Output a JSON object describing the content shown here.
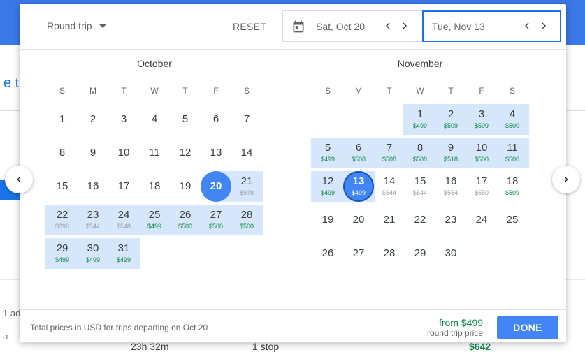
{
  "background": {
    "link_fragment": "e to",
    "adults_fragment": "1 ad",
    "plus_fragment": "+1",
    "duration": "23h 32m",
    "stops": "1 stop",
    "price": "$642"
  },
  "header": {
    "trip_type": "Round trip",
    "reset_label": "RESET",
    "depart_date": "Sat, Oct 20",
    "return_date": "Tue, Nov 13"
  },
  "weekdays": [
    "S",
    "M",
    "T",
    "W",
    "T",
    "F",
    "S"
  ],
  "months": [
    {
      "name": "October",
      "first_weekday": 1,
      "days": [
        {
          "d": "1"
        },
        {
          "d": "2"
        },
        {
          "d": "3"
        },
        {
          "d": "4"
        },
        {
          "d": "5"
        },
        {
          "d": "6"
        },
        {
          "d": "7"
        },
        {
          "d": "8"
        },
        {
          "d": "9"
        },
        {
          "d": "10"
        },
        {
          "d": "11"
        },
        {
          "d": "12"
        },
        {
          "d": "13"
        },
        {
          "d": "14"
        },
        {
          "d": "15"
        },
        {
          "d": "16"
        },
        {
          "d": "17"
        },
        {
          "d": "18"
        },
        {
          "d": "19"
        },
        {
          "d": "20",
          "selected": true,
          "range": true
        },
        {
          "d": "21",
          "p": "$978",
          "gray": true,
          "range": true
        },
        {
          "d": "22",
          "p": "$890",
          "gray": true,
          "range": true
        },
        {
          "d": "23",
          "p": "$544",
          "gray": true,
          "range": true
        },
        {
          "d": "24",
          "p": "$548",
          "gray": true,
          "range": true
        },
        {
          "d": "25",
          "p": "$499",
          "range": true
        },
        {
          "d": "26",
          "p": "$500",
          "range": true
        },
        {
          "d": "27",
          "p": "$500",
          "range": true
        },
        {
          "d": "28",
          "p": "$500",
          "range": true
        },
        {
          "d": "29",
          "p": "$499",
          "range": true
        },
        {
          "d": "30",
          "p": "$499",
          "range": true
        },
        {
          "d": "31",
          "p": "$499",
          "range": true
        }
      ]
    },
    {
      "name": "November",
      "first_weekday": 4,
      "days": [
        {
          "d": "1",
          "p": "$499",
          "range": true
        },
        {
          "d": "2",
          "p": "$509",
          "range": true
        },
        {
          "d": "3",
          "p": "$509",
          "range": true
        },
        {
          "d": "4",
          "p": "$500",
          "range": true
        },
        {
          "d": "5",
          "p": "$499",
          "range": true
        },
        {
          "d": "6",
          "p": "$508",
          "range": true
        },
        {
          "d": "7",
          "p": "$508",
          "range": true
        },
        {
          "d": "8",
          "p": "$508",
          "range": true
        },
        {
          "d": "9",
          "p": "$518",
          "range": true
        },
        {
          "d": "10",
          "p": "$500",
          "range": true
        },
        {
          "d": "11",
          "p": "$500",
          "range": true
        },
        {
          "d": "12",
          "p": "$499",
          "range": true
        },
        {
          "d": "13",
          "p": "$499",
          "selected": true,
          "ring": true,
          "range": true
        },
        {
          "d": "14",
          "p": "$544",
          "gray": true
        },
        {
          "d": "15",
          "p": "$544",
          "gray": true
        },
        {
          "d": "16",
          "p": "$554",
          "gray": true
        },
        {
          "d": "17",
          "p": "$550",
          "gray": true
        },
        {
          "d": "18",
          "p": "$509"
        },
        {
          "d": "19"
        },
        {
          "d": "20"
        },
        {
          "d": "21"
        },
        {
          "d": "22"
        },
        {
          "d": "23"
        },
        {
          "d": "24"
        },
        {
          "d": "25"
        },
        {
          "d": "26"
        },
        {
          "d": "27"
        },
        {
          "d": "28"
        },
        {
          "d": "29"
        },
        {
          "d": "30"
        }
      ]
    }
  ],
  "footer": {
    "note": "Total prices in USD for trips departing on Oct 20",
    "from_price": "from $499",
    "price_label": "round trip price",
    "done_label": "DONE"
  },
  "colors": {
    "accent": "#4285f4",
    "range": "#d6e6fb",
    "price_green": "#0d8a43",
    "price_gray": "#9aa0a6"
  },
  "icons": [
    "calendar-icon",
    "chevron-left-icon",
    "chevron-right-icon",
    "dropdown-caret-icon"
  ]
}
